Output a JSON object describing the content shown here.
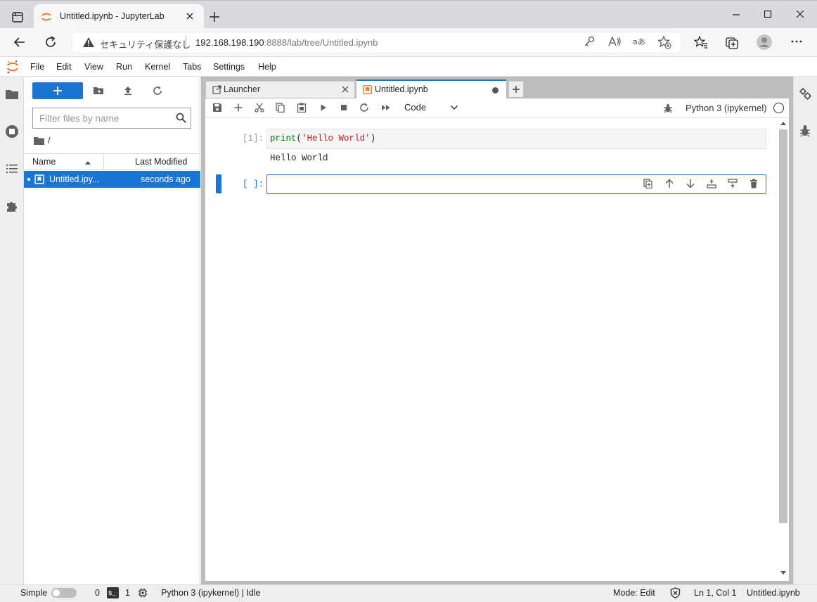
{
  "browser": {
    "tab_title": "Untitled.ipynb - JupyterLab",
    "security_label": "セキュリティ保護なし",
    "url_host": "192.168.198.190",
    "url_rest": ":8888/lab/tree/Untitled.ipynb"
  },
  "menubar": {
    "items": [
      "File",
      "Edit",
      "View",
      "Run",
      "Kernel",
      "Tabs",
      "Settings",
      "Help"
    ]
  },
  "filebrowser": {
    "filter_placeholder": "Filter files by name",
    "breadcrumb": "/",
    "col_name": "Name",
    "col_modified": "Last Modified",
    "files": [
      {
        "name": "Untitled.ipy...",
        "modified": "seconds ago",
        "selected": true
      }
    ]
  },
  "tabs": [
    {
      "label": "Launcher",
      "active": false
    },
    {
      "label": "Untitled.ipynb",
      "active": true,
      "dirty": true
    }
  ],
  "notebook_toolbar": {
    "cell_type": "Code",
    "kernel_name": "Python 3 (ipykernel)"
  },
  "cells": [
    {
      "prompt": "[1]:",
      "code_func": "print",
      "code_open": "(",
      "code_string": "'Hello World'",
      "code_close": ")",
      "output": "Hello World"
    },
    {
      "prompt": "[ ]:",
      "code": ""
    }
  ],
  "statusbar": {
    "mode_label": "Simple",
    "terminals_count": "0",
    "terminal_icon_text": "$_",
    "kernels_count": "1",
    "kernel_status": "Python 3 (ipykernel) | Idle",
    "mode": "Mode: Edit",
    "cursor": "Ln 1, Col 1",
    "filename": "Untitled.ipynb"
  },
  "colors": {
    "accent": "#1a76d2",
    "jupyter_orange": "#f37726"
  }
}
